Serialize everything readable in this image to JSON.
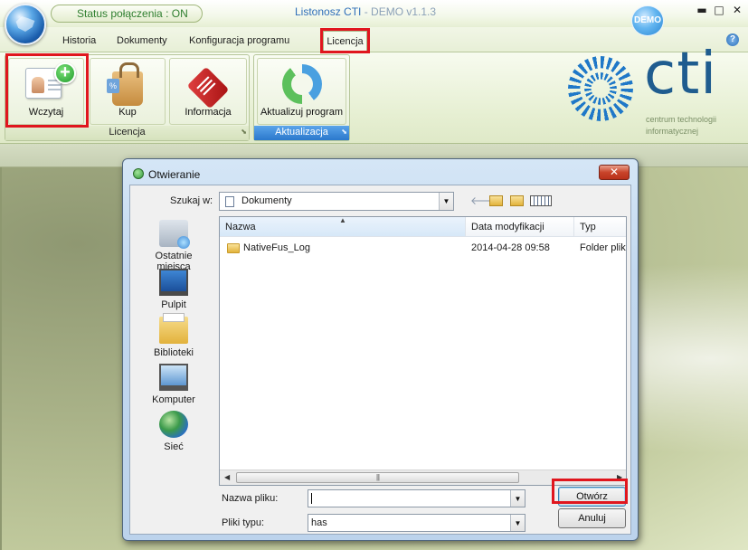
{
  "titlebar": {
    "status": "Status połączenia : ON",
    "app_title": "Listonosz CTI",
    "version": " - DEMO v1.1.3",
    "demo_badge": "DEMO",
    "minimize": "▬",
    "maximize": "□",
    "close": "✕"
  },
  "ribbon": {
    "tabs": [
      "Historia",
      "Dokumenty",
      "Konfiguracja programu",
      "Licencja"
    ],
    "help": "?",
    "groups": [
      {
        "label": "Licencja",
        "buttons": [
          {
            "label": "Wczytaj",
            "icon": "license-card-add-icon"
          },
          {
            "label": "Kup",
            "icon": "shopping-bag-icon"
          },
          {
            "label": "Informacja",
            "icon": "price-tag-icon"
          }
        ]
      },
      {
        "label": "Aktualizacja",
        "buttons": [
          {
            "label": "Aktualizuj program",
            "icon": "refresh-icon"
          }
        ]
      }
    ],
    "launcher": "⬊"
  },
  "logo": {
    "text": "cti",
    "subtitle_line1": "centrum technologii",
    "subtitle_line2": "informatycznej"
  },
  "dialog": {
    "title": "Otwieranie",
    "close": "✕",
    "lookin_label": "Szukaj w:",
    "lookin_value": "Dokumenty",
    "toolbar_icons": [
      "back-icon",
      "up-folder-icon",
      "new-folder-icon",
      "view-menu-icon"
    ],
    "places": [
      {
        "label": "Ostatnie miejsca",
        "icon": "recent-places-icon"
      },
      {
        "label": "Pulpit",
        "icon": "desktop-icon"
      },
      {
        "label": "Biblioteki",
        "icon": "libraries-icon"
      },
      {
        "label": "Komputer",
        "icon": "computer-icon"
      },
      {
        "label": "Sieć",
        "icon": "network-icon"
      }
    ],
    "columns": [
      "Nazwa",
      "Data modyfikacji",
      "Typ"
    ],
    "files": [
      {
        "name": "NativeFus_Log",
        "modified": "2014-04-28 09:58",
        "type": "Folder plik"
      }
    ],
    "filename_label": "Nazwa pliku:",
    "filename_value": "",
    "filetype_label": "Pliki typu:",
    "filetype_value": "has",
    "open_button": "Otwórz",
    "cancel_button": "Anuluj"
  },
  "colors": {
    "highlight": "#e0161e",
    "accent_blue": "#2f6fb9",
    "status_green": "#2f7f2f"
  }
}
